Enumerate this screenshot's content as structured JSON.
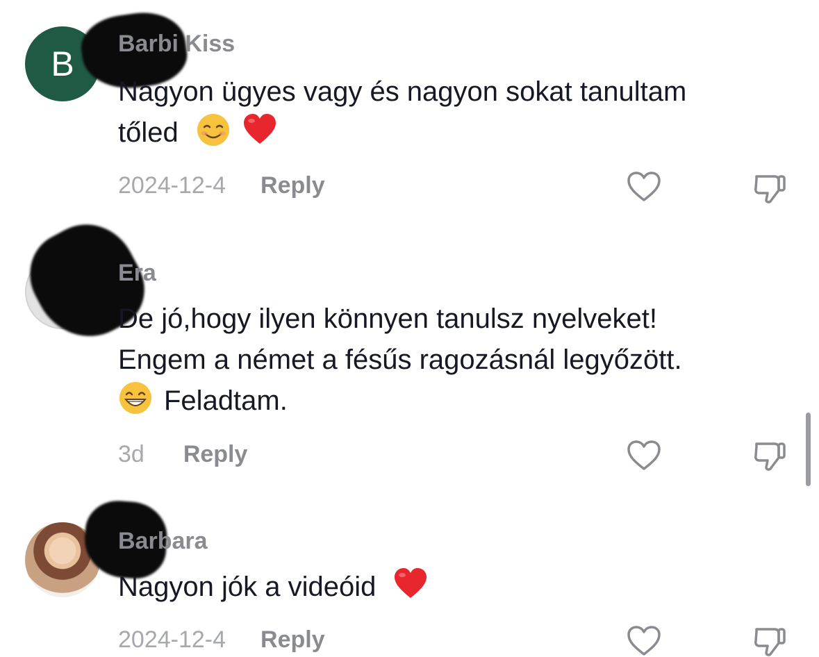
{
  "comments": [
    {
      "avatar_letter": "B",
      "username": "Barbi Kiss",
      "text_line1": "Nagyon ügyes vagy és nagyon sokat tanultam",
      "text_line2": "tőled",
      "date": "2024-12-4",
      "reply_label": "Reply",
      "emojis": [
        "smiling-face-icon",
        "red-heart-icon"
      ]
    },
    {
      "username": "Era",
      "text_line1": "De jó,hogy ilyen könnyen tanulsz nyelveket!",
      "text_line2": "Engem a német a fésűs ragozásnál legyőzött.",
      "text_line3": "Feladtam.",
      "date": "3d",
      "reply_label": "Reply",
      "emojis": [
        "grinning-face-icon"
      ]
    },
    {
      "username": "Barbara",
      "text_line1": "Nagyon jók a videóid",
      "date": "2024-12-4",
      "reply_label": "Reply",
      "emojis": [
        "red-heart-icon"
      ]
    }
  ],
  "colors": {
    "avatar_b": "#1f5a45",
    "meta_text": "#a7a8ad",
    "reply_text": "#8a8b91",
    "heart": "#e8262d"
  }
}
